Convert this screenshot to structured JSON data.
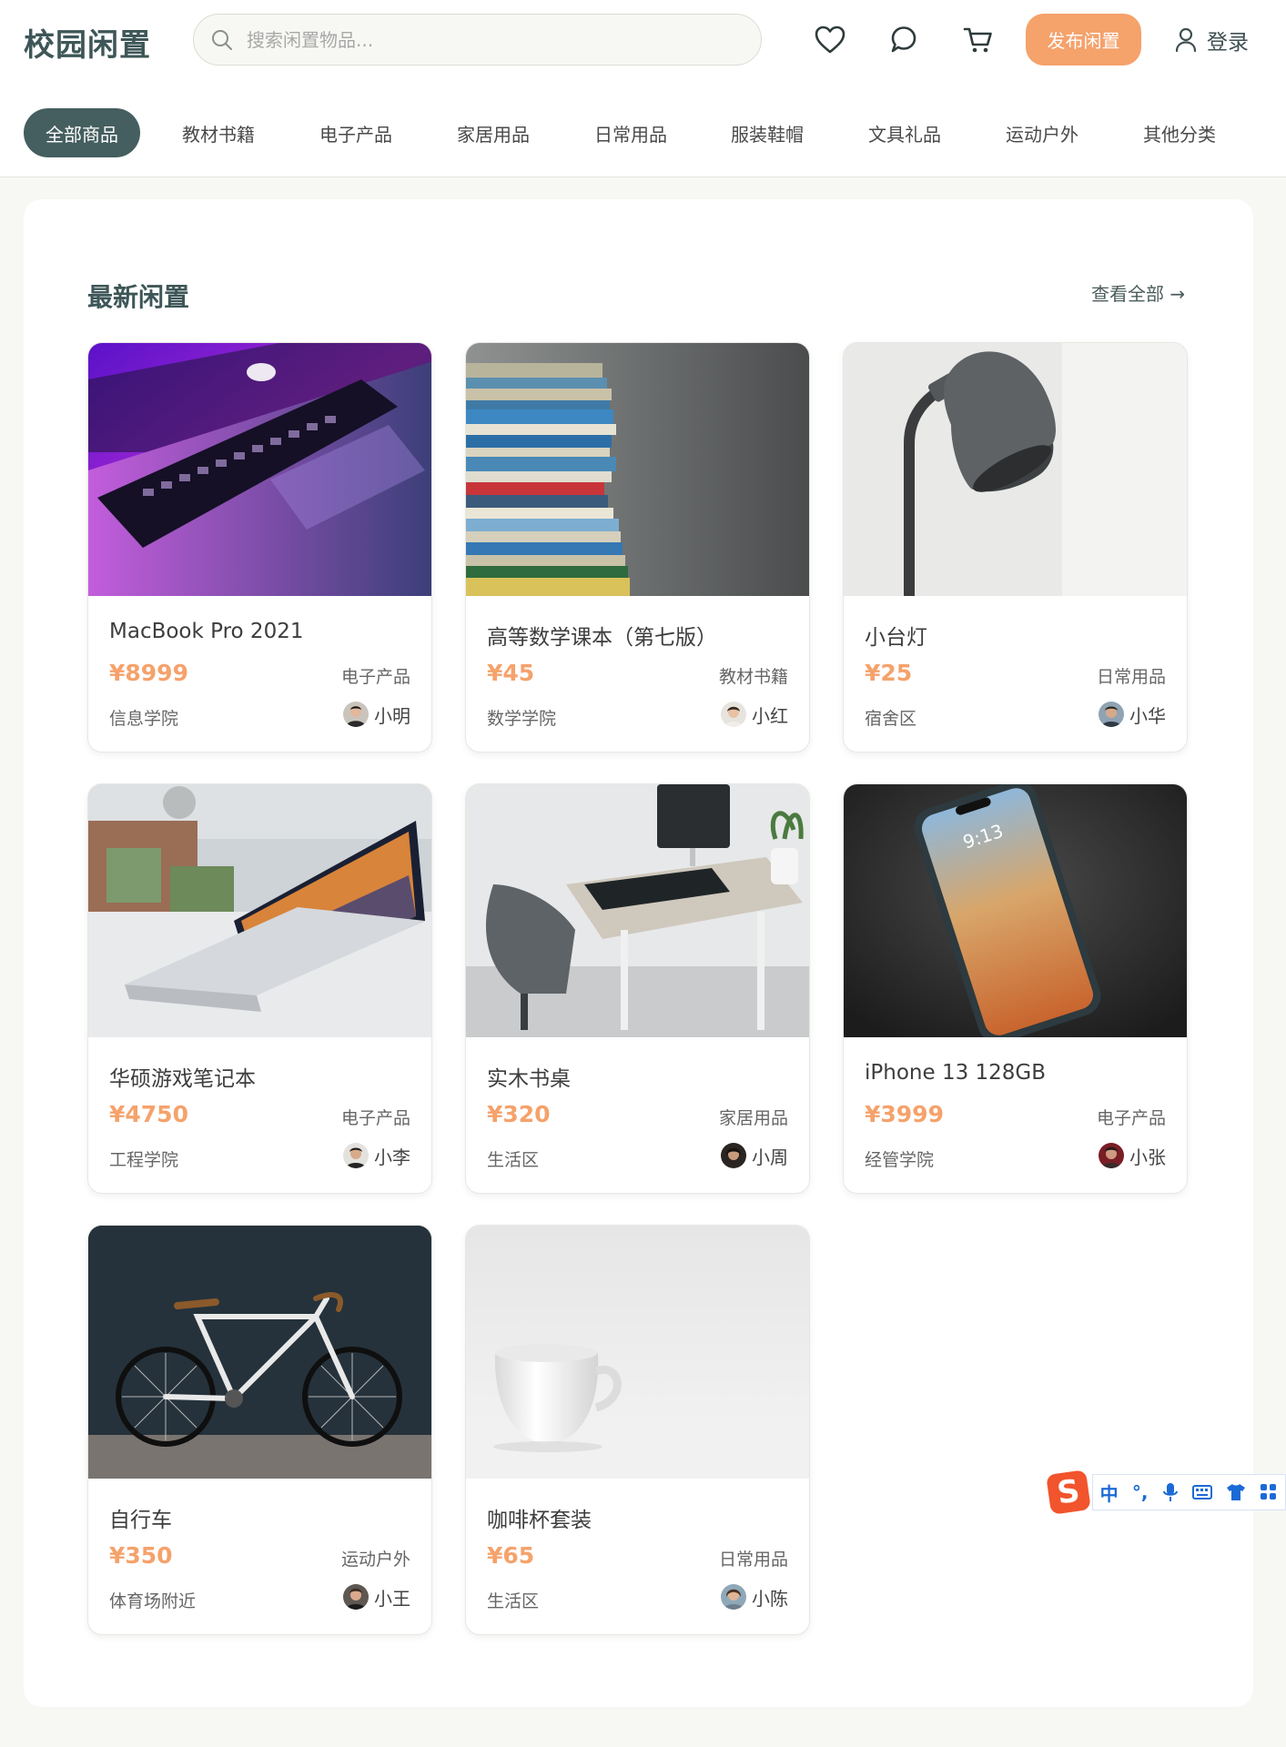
{
  "header": {
    "logo": "校园闲置",
    "search_placeholder": "搜索闲置物品...",
    "publish_label": "发布闲置",
    "login_label": "登录",
    "icons": [
      "heart-icon",
      "chat-icon",
      "cart-icon",
      "user-icon",
      "search-icon"
    ]
  },
  "categories": [
    {
      "label": "全部商品",
      "active": true
    },
    {
      "label": "教材书籍",
      "active": false
    },
    {
      "label": "电子产品",
      "active": false
    },
    {
      "label": "家居用品",
      "active": false
    },
    {
      "label": "日常用品",
      "active": false
    },
    {
      "label": "服装鞋帽",
      "active": false
    },
    {
      "label": "文具礼品",
      "active": false
    },
    {
      "label": "运动户外",
      "active": false
    },
    {
      "label": "其他分类",
      "active": false
    }
  ],
  "section": {
    "title": "最新闲置",
    "view_all": "查看全部 →"
  },
  "products": [
    {
      "name": "MacBook Pro 2021",
      "price": "¥8999",
      "category": "电子产品",
      "location": "信息学院",
      "seller": "小明"
    },
    {
      "name": "高等数学课本（第七版）",
      "price": "¥45",
      "category": "教材书籍",
      "location": "数学学院",
      "seller": "小红"
    },
    {
      "name": "小台灯",
      "price": "¥25",
      "category": "日常用品",
      "location": "宿舍区",
      "seller": "小华"
    },
    {
      "name": "华硕游戏笔记本",
      "price": "¥4750",
      "category": "电子产品",
      "location": "工程学院",
      "seller": "小李"
    },
    {
      "name": "实木书桌",
      "price": "¥320",
      "category": "家居用品",
      "location": "生活区",
      "seller": "小周"
    },
    {
      "name": "iPhone 13 128GB",
      "price": "¥3999",
      "category": "电子产品",
      "location": "经管学院",
      "seller": "小张"
    },
    {
      "name": "自行车",
      "price": "¥350",
      "category": "运动户外",
      "location": "体育场附近",
      "seller": "小王"
    },
    {
      "name": "咖啡杯套装",
      "price": "¥65",
      "category": "日常用品",
      "location": "生活区",
      "seller": "小陈"
    }
  ],
  "ime": {
    "logo": "S",
    "mode": "中",
    "punct": "°,"
  },
  "colors": {
    "accent": "#f5a26b",
    "brand": "#455e5f",
    "background": "#f7f8f3"
  }
}
